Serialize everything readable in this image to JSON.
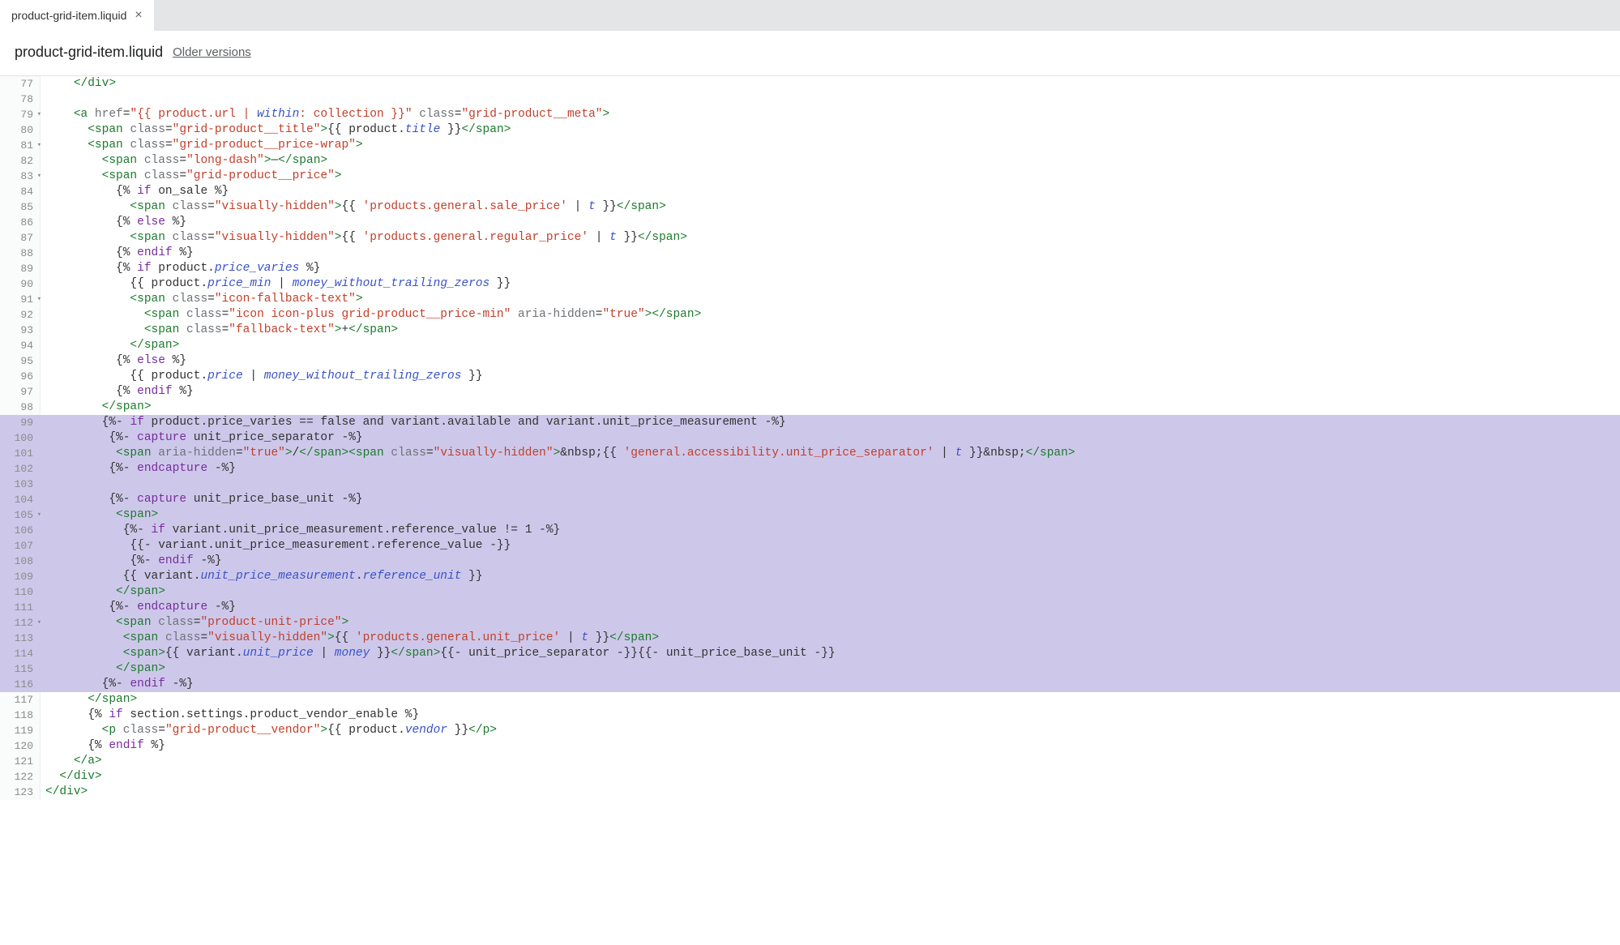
{
  "tab": {
    "label": "product-grid-item.liquid",
    "close": "×"
  },
  "header": {
    "filename": "product-grid-item.liquid",
    "older_versions": "Older versions"
  },
  "gutter": {
    "start": 77,
    "end": 123,
    "folds": [
      79,
      81,
      83,
      91,
      105,
      112
    ]
  },
  "hl_start": 99,
  "hl_end": 116,
  "code": {
    "77": [
      [
        "txt",
        "    "
      ],
      [
        "angle",
        "</"
      ],
      [
        "tag",
        "div"
      ],
      [
        "angle",
        ">"
      ]
    ],
    "78": [],
    "79": [
      [
        "txt",
        "    "
      ],
      [
        "angle",
        "<"
      ],
      [
        "tag",
        "a"
      ],
      [
        "txt",
        " "
      ],
      [
        "attr",
        "href"
      ],
      [
        "eq",
        "="
      ],
      [
        "str",
        "\"{{ product.url | "
      ],
      [
        "filter",
        "within"
      ],
      [
        "str",
        ": collection }}\""
      ],
      [
        "txt",
        " "
      ],
      [
        "attr",
        "class"
      ],
      [
        "eq",
        "="
      ],
      [
        "str",
        "\"grid-product__meta\""
      ],
      [
        "angle",
        ">"
      ]
    ],
    "80": [
      [
        "txt",
        "      "
      ],
      [
        "angle",
        "<"
      ],
      [
        "tag",
        "span"
      ],
      [
        "txt",
        " "
      ],
      [
        "attr",
        "class"
      ],
      [
        "eq",
        "="
      ],
      [
        "str",
        "\"grid-product__title\""
      ],
      [
        "angle",
        ">"
      ],
      [
        "liqdelim",
        "{{ "
      ],
      [
        "txt",
        "product."
      ],
      [
        "field",
        "title"
      ],
      [
        "liqdelim",
        " }}"
      ],
      [
        "angle",
        "</"
      ],
      [
        "tag",
        "span"
      ],
      [
        "angle",
        ">"
      ]
    ],
    "81": [
      [
        "txt",
        "      "
      ],
      [
        "angle",
        "<"
      ],
      [
        "tag",
        "span"
      ],
      [
        "txt",
        " "
      ],
      [
        "attr",
        "class"
      ],
      [
        "eq",
        "="
      ],
      [
        "str",
        "\"grid-product__price-wrap\""
      ],
      [
        "angle",
        ">"
      ]
    ],
    "82": [
      [
        "txt",
        "        "
      ],
      [
        "angle",
        "<"
      ],
      [
        "tag",
        "span"
      ],
      [
        "txt",
        " "
      ],
      [
        "attr",
        "class"
      ],
      [
        "eq",
        "="
      ],
      [
        "str",
        "\"long-dash\""
      ],
      [
        "angle",
        ">"
      ],
      [
        "txt",
        "—"
      ],
      [
        "angle",
        "</"
      ],
      [
        "tag",
        "span"
      ],
      [
        "angle",
        ">"
      ]
    ],
    "83": [
      [
        "txt",
        "        "
      ],
      [
        "angle",
        "<"
      ],
      [
        "tag",
        "span"
      ],
      [
        "txt",
        " "
      ],
      [
        "attr",
        "class"
      ],
      [
        "eq",
        "="
      ],
      [
        "str",
        "\"grid-product__price\""
      ],
      [
        "angle",
        ">"
      ]
    ],
    "84": [
      [
        "txt",
        "          "
      ],
      [
        "liqdelim",
        "{% "
      ],
      [
        "kw",
        "if"
      ],
      [
        "txt",
        " on_sale "
      ],
      [
        "liqdelim",
        "%}"
      ]
    ],
    "85": [
      [
        "txt",
        "            "
      ],
      [
        "angle",
        "<"
      ],
      [
        "tag",
        "span"
      ],
      [
        "txt",
        " "
      ],
      [
        "attr",
        "class"
      ],
      [
        "eq",
        "="
      ],
      [
        "str",
        "\"visually-hidden\""
      ],
      [
        "angle",
        ">"
      ],
      [
        "liqdelim",
        "{{ "
      ],
      [
        "str",
        "'products.general.sale_price'"
      ],
      [
        "txt",
        " | "
      ],
      [
        "field",
        "t"
      ],
      [
        "liqdelim",
        " }}"
      ],
      [
        "angle",
        "</"
      ],
      [
        "tag",
        "span"
      ],
      [
        "angle",
        ">"
      ]
    ],
    "86": [
      [
        "txt",
        "          "
      ],
      [
        "liqdelim",
        "{% "
      ],
      [
        "kw",
        "else"
      ],
      [
        "liqdelim",
        " %}"
      ]
    ],
    "87": [
      [
        "txt",
        "            "
      ],
      [
        "angle",
        "<"
      ],
      [
        "tag",
        "span"
      ],
      [
        "txt",
        " "
      ],
      [
        "attr",
        "class"
      ],
      [
        "eq",
        "="
      ],
      [
        "str",
        "\"visually-hidden\""
      ],
      [
        "angle",
        ">"
      ],
      [
        "liqdelim",
        "{{ "
      ],
      [
        "str",
        "'products.general.regular_price'"
      ],
      [
        "txt",
        " | "
      ],
      [
        "field",
        "t"
      ],
      [
        "liqdelim",
        " }}"
      ],
      [
        "angle",
        "</"
      ],
      [
        "tag",
        "span"
      ],
      [
        "angle",
        ">"
      ]
    ],
    "88": [
      [
        "txt",
        "          "
      ],
      [
        "liqdelim",
        "{% "
      ],
      [
        "kw",
        "endif"
      ],
      [
        "liqdelim",
        " %}"
      ]
    ],
    "89": [
      [
        "txt",
        "          "
      ],
      [
        "liqdelim",
        "{% "
      ],
      [
        "kw",
        "if"
      ],
      [
        "txt",
        " product."
      ],
      [
        "field",
        "price_varies"
      ],
      [
        "liqdelim",
        " %}"
      ]
    ],
    "90": [
      [
        "txt",
        "            "
      ],
      [
        "liqdelim",
        "{{ "
      ],
      [
        "txt",
        "product."
      ],
      [
        "field",
        "price_min"
      ],
      [
        "txt",
        " | "
      ],
      [
        "filter",
        "money_without_trailing_zeros"
      ],
      [
        "liqdelim",
        " }}"
      ]
    ],
    "91": [
      [
        "txt",
        "            "
      ],
      [
        "angle",
        "<"
      ],
      [
        "tag",
        "span"
      ],
      [
        "txt",
        " "
      ],
      [
        "attr",
        "class"
      ],
      [
        "eq",
        "="
      ],
      [
        "str",
        "\"icon-fallback-text\""
      ],
      [
        "angle",
        ">"
      ]
    ],
    "92": [
      [
        "txt",
        "              "
      ],
      [
        "angle",
        "<"
      ],
      [
        "tag",
        "span"
      ],
      [
        "txt",
        " "
      ],
      [
        "attr",
        "class"
      ],
      [
        "eq",
        "="
      ],
      [
        "str",
        "\"icon icon-plus grid-product__price-min\""
      ],
      [
        "txt",
        " "
      ],
      [
        "attr",
        "aria-hidden"
      ],
      [
        "eq",
        "="
      ],
      [
        "str",
        "\"true\""
      ],
      [
        "angle",
        ">"
      ],
      [
        "angle",
        "</"
      ],
      [
        "tag",
        "span"
      ],
      [
        "angle",
        ">"
      ]
    ],
    "93": [
      [
        "txt",
        "              "
      ],
      [
        "angle",
        "<"
      ],
      [
        "tag",
        "span"
      ],
      [
        "txt",
        " "
      ],
      [
        "attr",
        "class"
      ],
      [
        "eq",
        "="
      ],
      [
        "str",
        "\"fallback-text\""
      ],
      [
        "angle",
        ">"
      ],
      [
        "txt",
        "+"
      ],
      [
        "angle",
        "</"
      ],
      [
        "tag",
        "span"
      ],
      [
        "angle",
        ">"
      ]
    ],
    "94": [
      [
        "txt",
        "            "
      ],
      [
        "angle",
        "</"
      ],
      [
        "tag",
        "span"
      ],
      [
        "angle",
        ">"
      ]
    ],
    "95": [
      [
        "txt",
        "          "
      ],
      [
        "liqdelim",
        "{% "
      ],
      [
        "kw",
        "else"
      ],
      [
        "liqdelim",
        " %}"
      ]
    ],
    "96": [
      [
        "txt",
        "            "
      ],
      [
        "liqdelim",
        "{{ "
      ],
      [
        "txt",
        "product."
      ],
      [
        "field",
        "price"
      ],
      [
        "txt",
        " | "
      ],
      [
        "filter",
        "money_without_trailing_zeros"
      ],
      [
        "liqdelim",
        " }}"
      ]
    ],
    "97": [
      [
        "txt",
        "          "
      ],
      [
        "liqdelim",
        "{% "
      ],
      [
        "kw",
        "endif"
      ],
      [
        "liqdelim",
        " %}"
      ]
    ],
    "98": [
      [
        "txt",
        "        "
      ],
      [
        "angle",
        "</"
      ],
      [
        "tag",
        "span"
      ],
      [
        "angle",
        ">"
      ]
    ],
    "99": [
      [
        "txt",
        "        "
      ],
      [
        "liqdelim",
        "{%- "
      ],
      [
        "kw",
        "if"
      ],
      [
        "txt",
        " product.price_varies == false and variant.available and variant.unit_price_measurement "
      ],
      [
        "liqdelim",
        "-%}"
      ]
    ],
    "100": [
      [
        "txt",
        "         "
      ],
      [
        "liqdelim",
        "{%- "
      ],
      [
        "kw",
        "capture"
      ],
      [
        "txt",
        " unit_price_separator "
      ],
      [
        "liqdelim",
        "-%}"
      ]
    ],
    "101": [
      [
        "txt",
        "          "
      ],
      [
        "angle",
        "<"
      ],
      [
        "tag",
        "span"
      ],
      [
        "txt",
        " "
      ],
      [
        "attr",
        "aria-hidden"
      ],
      [
        "eq",
        "="
      ],
      [
        "str",
        "\"true\""
      ],
      [
        "angle",
        ">"
      ],
      [
        "txt",
        "/"
      ],
      [
        "angle",
        "</"
      ],
      [
        "tag",
        "span"
      ],
      [
        "angle",
        ">"
      ],
      [
        "angle",
        "<"
      ],
      [
        "tag",
        "span"
      ],
      [
        "txt",
        " "
      ],
      [
        "attr",
        "class"
      ],
      [
        "eq",
        "="
      ],
      [
        "str",
        "\"visually-hidden\""
      ],
      [
        "angle",
        ">"
      ],
      [
        "txt",
        "&nbsp;"
      ],
      [
        "liqdelim",
        "{{ "
      ],
      [
        "str",
        "'general.accessibility.unit_price_separator'"
      ],
      [
        "txt",
        " | "
      ],
      [
        "field",
        "t"
      ],
      [
        "liqdelim",
        " }}"
      ],
      [
        "txt",
        "&nbsp;"
      ],
      [
        "angle",
        "</"
      ],
      [
        "tag",
        "span"
      ],
      [
        "angle",
        ">"
      ]
    ],
    "102": [
      [
        "txt",
        "         "
      ],
      [
        "liqdelim",
        "{%- "
      ],
      [
        "kw",
        "endcapture"
      ],
      [
        "liqdelim",
        " -%}"
      ]
    ],
    "103": [],
    "104": [
      [
        "txt",
        "         "
      ],
      [
        "liqdelim",
        "{%- "
      ],
      [
        "kw",
        "capture"
      ],
      [
        "txt",
        " unit_price_base_unit "
      ],
      [
        "liqdelim",
        "-%}"
      ]
    ],
    "105": [
      [
        "txt",
        "          "
      ],
      [
        "angle",
        "<"
      ],
      [
        "tag",
        "span"
      ],
      [
        "angle",
        ">"
      ]
    ],
    "106": [
      [
        "txt",
        "           "
      ],
      [
        "liqdelim",
        "{%- "
      ],
      [
        "kw",
        "if"
      ],
      [
        "txt",
        " variant.unit_price_measurement.reference_value != 1 "
      ],
      [
        "liqdelim",
        "-%}"
      ]
    ],
    "107": [
      [
        "txt",
        "            "
      ],
      [
        "liqdelim",
        "{{- "
      ],
      [
        "txt",
        "variant.unit_price_measurement.reference_value "
      ],
      [
        "liqdelim",
        "-}}"
      ]
    ],
    "108": [
      [
        "txt",
        "            "
      ],
      [
        "liqdelim",
        "{%- "
      ],
      [
        "kw",
        "endif"
      ],
      [
        "liqdelim",
        " -%}"
      ]
    ],
    "109": [
      [
        "txt",
        "           "
      ],
      [
        "liqdelim",
        "{{ "
      ],
      [
        "txt",
        "variant."
      ],
      [
        "field",
        "unit_price_measurement"
      ],
      [
        "txt",
        "."
      ],
      [
        "field",
        "reference_unit"
      ],
      [
        "liqdelim",
        " }}"
      ]
    ],
    "110": [
      [
        "txt",
        "          "
      ],
      [
        "angle",
        "</"
      ],
      [
        "tag",
        "span"
      ],
      [
        "angle",
        ">"
      ]
    ],
    "111": [
      [
        "txt",
        "         "
      ],
      [
        "liqdelim",
        "{%- "
      ],
      [
        "kw",
        "endcapture"
      ],
      [
        "liqdelim",
        " -%}"
      ]
    ],
    "112": [
      [
        "txt",
        "          "
      ],
      [
        "angle",
        "<"
      ],
      [
        "tag",
        "span"
      ],
      [
        "txt",
        " "
      ],
      [
        "attr",
        "class"
      ],
      [
        "eq",
        "="
      ],
      [
        "str",
        "\"product-unit-price\""
      ],
      [
        "angle",
        ">"
      ]
    ],
    "113": [
      [
        "txt",
        "           "
      ],
      [
        "angle",
        "<"
      ],
      [
        "tag",
        "span"
      ],
      [
        "txt",
        " "
      ],
      [
        "attr",
        "class"
      ],
      [
        "eq",
        "="
      ],
      [
        "str",
        "\"visually-hidden\""
      ],
      [
        "angle",
        ">"
      ],
      [
        "liqdelim",
        "{{ "
      ],
      [
        "str",
        "'products.general.unit_price'"
      ],
      [
        "txt",
        " | "
      ],
      [
        "field",
        "t"
      ],
      [
        "liqdelim",
        " }}"
      ],
      [
        "angle",
        "</"
      ],
      [
        "tag",
        "span"
      ],
      [
        "angle",
        ">"
      ]
    ],
    "114": [
      [
        "txt",
        "           "
      ],
      [
        "angle",
        "<"
      ],
      [
        "tag",
        "span"
      ],
      [
        "angle",
        ">"
      ],
      [
        "liqdelim",
        "{{ "
      ],
      [
        "txt",
        "variant."
      ],
      [
        "field",
        "unit_price"
      ],
      [
        "txt",
        " | "
      ],
      [
        "filter",
        "money"
      ],
      [
        "liqdelim",
        " }}"
      ],
      [
        "angle",
        "</"
      ],
      [
        "tag",
        "span"
      ],
      [
        "angle",
        ">"
      ],
      [
        "liqdelim",
        "{{- "
      ],
      [
        "txt",
        "unit_price_separator "
      ],
      [
        "liqdelim",
        "-}}"
      ],
      [
        "liqdelim",
        "{{- "
      ],
      [
        "txt",
        "unit_price_base_unit "
      ],
      [
        "liqdelim",
        "-}}"
      ]
    ],
    "115": [
      [
        "txt",
        "          "
      ],
      [
        "angle",
        "</"
      ],
      [
        "tag",
        "span"
      ],
      [
        "angle",
        ">"
      ]
    ],
    "116": [
      [
        "txt",
        "        "
      ],
      [
        "liqdelim",
        "{%- "
      ],
      [
        "kw",
        "endif"
      ],
      [
        "liqdelim",
        " -%}"
      ]
    ],
    "117": [
      [
        "txt",
        "      "
      ],
      [
        "angle",
        "</"
      ],
      [
        "tag",
        "span"
      ],
      [
        "angle",
        ">"
      ]
    ],
    "118": [
      [
        "txt",
        "      "
      ],
      [
        "liqdelim",
        "{% "
      ],
      [
        "kw",
        "if"
      ],
      [
        "txt",
        " section.settings.product_vendor_enable "
      ],
      [
        "liqdelim",
        "%}"
      ]
    ],
    "119": [
      [
        "txt",
        "        "
      ],
      [
        "angle",
        "<"
      ],
      [
        "tag",
        "p"
      ],
      [
        "txt",
        " "
      ],
      [
        "attr",
        "class"
      ],
      [
        "eq",
        "="
      ],
      [
        "str",
        "\"grid-product__vendor\""
      ],
      [
        "angle",
        ">"
      ],
      [
        "liqdelim",
        "{{ "
      ],
      [
        "txt",
        "product."
      ],
      [
        "field",
        "vendor"
      ],
      [
        "liqdelim",
        " }}"
      ],
      [
        "angle",
        "</"
      ],
      [
        "tag",
        "p"
      ],
      [
        "angle",
        ">"
      ]
    ],
    "120": [
      [
        "txt",
        "      "
      ],
      [
        "liqdelim",
        "{% "
      ],
      [
        "kw",
        "endif"
      ],
      [
        "liqdelim",
        " %}"
      ]
    ],
    "121": [
      [
        "txt",
        "    "
      ],
      [
        "angle",
        "</"
      ],
      [
        "tag",
        "a"
      ],
      [
        "angle",
        ">"
      ]
    ],
    "122": [
      [
        "txt",
        "  "
      ],
      [
        "angle",
        "</"
      ],
      [
        "tag",
        "div"
      ],
      [
        "angle",
        ">"
      ]
    ],
    "123": [
      [
        "angle",
        "</"
      ],
      [
        "tag",
        "div"
      ],
      [
        "angle",
        ">"
      ]
    ]
  }
}
